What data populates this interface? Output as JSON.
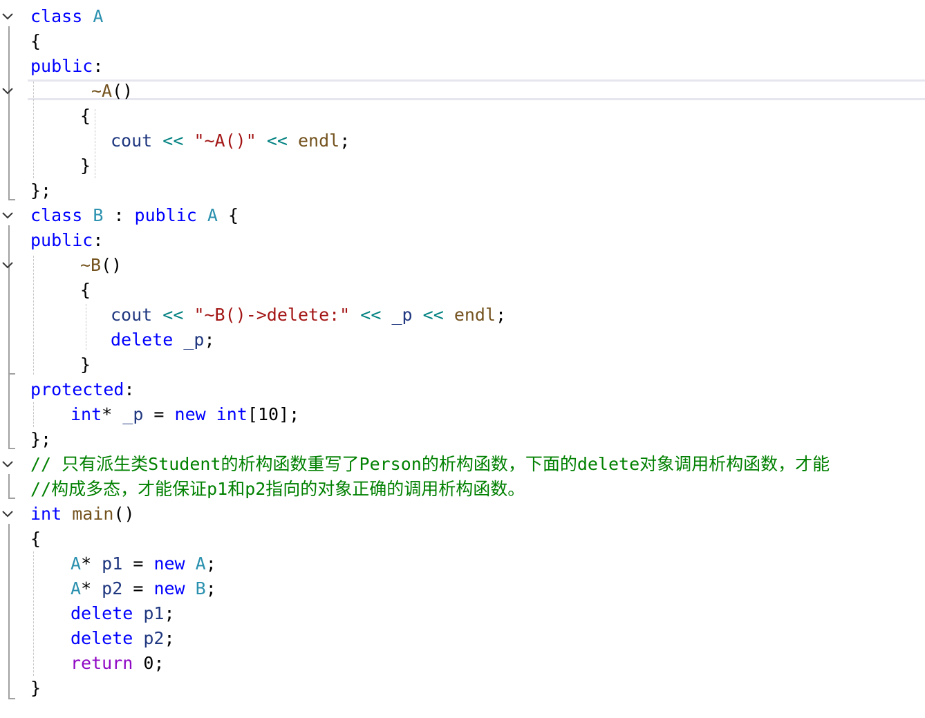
{
  "editor": {
    "language": "C++",
    "lines": [
      {
        "id": "l1",
        "tokens": [
          {
            "t": "class",
            "c": "kw"
          },
          {
            "t": " "
          },
          {
            "t": "A",
            "c": "type"
          }
        ]
      },
      {
        "id": "l2",
        "tokens": [
          {
            "t": "{",
            "c": "punc"
          }
        ]
      },
      {
        "id": "l3",
        "tokens": [
          {
            "t": "public",
            "c": "kw"
          },
          {
            "t": ":",
            "c": "punc"
          }
        ]
      },
      {
        "id": "l4",
        "tokens": [
          {
            "t": "~A",
            "c": "fn"
          },
          {
            "t": "()",
            "c": "punc"
          }
        ]
      },
      {
        "id": "l5",
        "tokens": [
          {
            "t": "{",
            "c": "punc"
          }
        ]
      },
      {
        "id": "l6",
        "tokens": [
          {
            "t": "cout",
            "c": "var"
          },
          {
            "t": " "
          },
          {
            "t": "<<",
            "c": "op"
          },
          {
            "t": " "
          },
          {
            "t": "\"~A()\"",
            "c": "str"
          },
          {
            "t": " "
          },
          {
            "t": "<<",
            "c": "op"
          },
          {
            "t": " "
          },
          {
            "t": "endl",
            "c": "fn"
          },
          {
            "t": ";",
            "c": "punc"
          }
        ]
      },
      {
        "id": "l7",
        "tokens": [
          {
            "t": "}",
            "c": "punc"
          }
        ]
      },
      {
        "id": "l8",
        "tokens": [
          {
            "t": "};",
            "c": "punc"
          }
        ]
      },
      {
        "id": "l9",
        "tokens": [
          {
            "t": "class",
            "c": "kw"
          },
          {
            "t": " "
          },
          {
            "t": "B",
            "c": "type"
          },
          {
            "t": " : ",
            "c": "punc"
          },
          {
            "t": "public",
            "c": "kw"
          },
          {
            "t": " "
          },
          {
            "t": "A",
            "c": "type"
          },
          {
            "t": " {",
            "c": "punc"
          }
        ]
      },
      {
        "id": "l10",
        "tokens": [
          {
            "t": "public",
            "c": "kw"
          },
          {
            "t": ":",
            "c": "punc"
          }
        ]
      },
      {
        "id": "l11",
        "tokens": [
          {
            "t": "~B",
            "c": "fn"
          },
          {
            "t": "()",
            "c": "punc"
          }
        ]
      },
      {
        "id": "l12",
        "tokens": [
          {
            "t": "{",
            "c": "punc"
          }
        ]
      },
      {
        "id": "l13",
        "tokens": [
          {
            "t": "cout",
            "c": "var"
          },
          {
            "t": " "
          },
          {
            "t": "<<",
            "c": "op"
          },
          {
            "t": " "
          },
          {
            "t": "\"~B()->delete:\"",
            "c": "str"
          },
          {
            "t": " "
          },
          {
            "t": "<<",
            "c": "op"
          },
          {
            "t": " "
          },
          {
            "t": "_p",
            "c": "var"
          },
          {
            "t": " "
          },
          {
            "t": "<<",
            "c": "op"
          },
          {
            "t": " "
          },
          {
            "t": "endl",
            "c": "fn"
          },
          {
            "t": ";",
            "c": "punc"
          }
        ]
      },
      {
        "id": "l14",
        "tokens": [
          {
            "t": "delete",
            "c": "kw"
          },
          {
            "t": " "
          },
          {
            "t": "_p",
            "c": "var"
          },
          {
            "t": ";",
            "c": "punc"
          }
        ]
      },
      {
        "id": "l15",
        "tokens": [
          {
            "t": "}",
            "c": "punc"
          }
        ]
      },
      {
        "id": "l16",
        "tokens": [
          {
            "t": "protected",
            "c": "kw"
          },
          {
            "t": ":",
            "c": "punc"
          }
        ]
      },
      {
        "id": "l17",
        "tokens": [
          {
            "t": "int",
            "c": "kw"
          },
          {
            "t": "* ",
            "c": "punc"
          },
          {
            "t": "_p",
            "c": "var"
          },
          {
            "t": " = ",
            "c": "punc"
          },
          {
            "t": "new",
            "c": "kw"
          },
          {
            "t": " "
          },
          {
            "t": "int",
            "c": "kw"
          },
          {
            "t": "[",
            "c": "punc"
          },
          {
            "t": "10",
            "c": "num"
          },
          {
            "t": "];",
            "c": "punc"
          }
        ]
      },
      {
        "id": "l18",
        "tokens": [
          {
            "t": "};",
            "c": "punc"
          }
        ]
      },
      {
        "id": "l19",
        "tokens": [
          {
            "t": "// 只有派生类Student的析构函数重写了Person的析构函数，下面的delete对象调用析构函数，才能",
            "c": "cmt"
          }
        ]
      },
      {
        "id": "l20",
        "tokens": [
          {
            "t": "//构成多态，才能保证p1和p2指向的对象正确的调用析构函数。",
            "c": "cmt"
          }
        ]
      },
      {
        "id": "l21",
        "tokens": [
          {
            "t": "int",
            "c": "kw"
          },
          {
            "t": " "
          },
          {
            "t": "main",
            "c": "fn"
          },
          {
            "t": "()",
            "c": "punc"
          }
        ]
      },
      {
        "id": "l22",
        "tokens": [
          {
            "t": "{",
            "c": "punc"
          }
        ]
      },
      {
        "id": "l23",
        "tokens": [
          {
            "t": "A",
            "c": "type"
          },
          {
            "t": "* ",
            "c": "punc"
          },
          {
            "t": "p1",
            "c": "var"
          },
          {
            "t": " = ",
            "c": "punc"
          },
          {
            "t": "new",
            "c": "kw"
          },
          {
            "t": " "
          },
          {
            "t": "A",
            "c": "type"
          },
          {
            "t": ";",
            "c": "punc"
          }
        ]
      },
      {
        "id": "l24",
        "tokens": [
          {
            "t": "A",
            "c": "type"
          },
          {
            "t": "* ",
            "c": "punc"
          },
          {
            "t": "p2",
            "c": "var"
          },
          {
            "t": " = ",
            "c": "punc"
          },
          {
            "t": "new",
            "c": "kw"
          },
          {
            "t": " "
          },
          {
            "t": "B",
            "c": "type"
          },
          {
            "t": ";",
            "c": "punc"
          }
        ]
      },
      {
        "id": "l25",
        "tokens": [
          {
            "t": "delete",
            "c": "kw"
          },
          {
            "t": " "
          },
          {
            "t": "p1",
            "c": "var"
          },
          {
            "t": ";",
            "c": "punc"
          }
        ]
      },
      {
        "id": "l26",
        "tokens": [
          {
            "t": "delete",
            "c": "kw"
          },
          {
            "t": " "
          },
          {
            "t": "p2",
            "c": "var"
          },
          {
            "t": ";",
            "c": "punc"
          }
        ]
      },
      {
        "id": "l27",
        "tokens": [
          {
            "t": "return",
            "c": "ctl"
          },
          {
            "t": " "
          },
          {
            "t": "0",
            "c": "num"
          },
          {
            "t": ";",
            "c": "punc"
          }
        ]
      },
      {
        "id": "l28",
        "tokens": [
          {
            "t": "}",
            "c": "punc"
          }
        ]
      }
    ],
    "fold_markers": [
      "l1",
      "l4",
      "l9",
      "l11",
      "l19",
      "l21"
    ],
    "colors": {
      "keyword": "#0000ff",
      "type": "#2b91af",
      "string": "#a31515",
      "comment": "#008000",
      "function": "#74531f",
      "variable": "#1f377f",
      "control": "#8f08c4",
      "operator": "#008080"
    },
    "icons": {
      "fold": "chevron-down-icon"
    }
  }
}
